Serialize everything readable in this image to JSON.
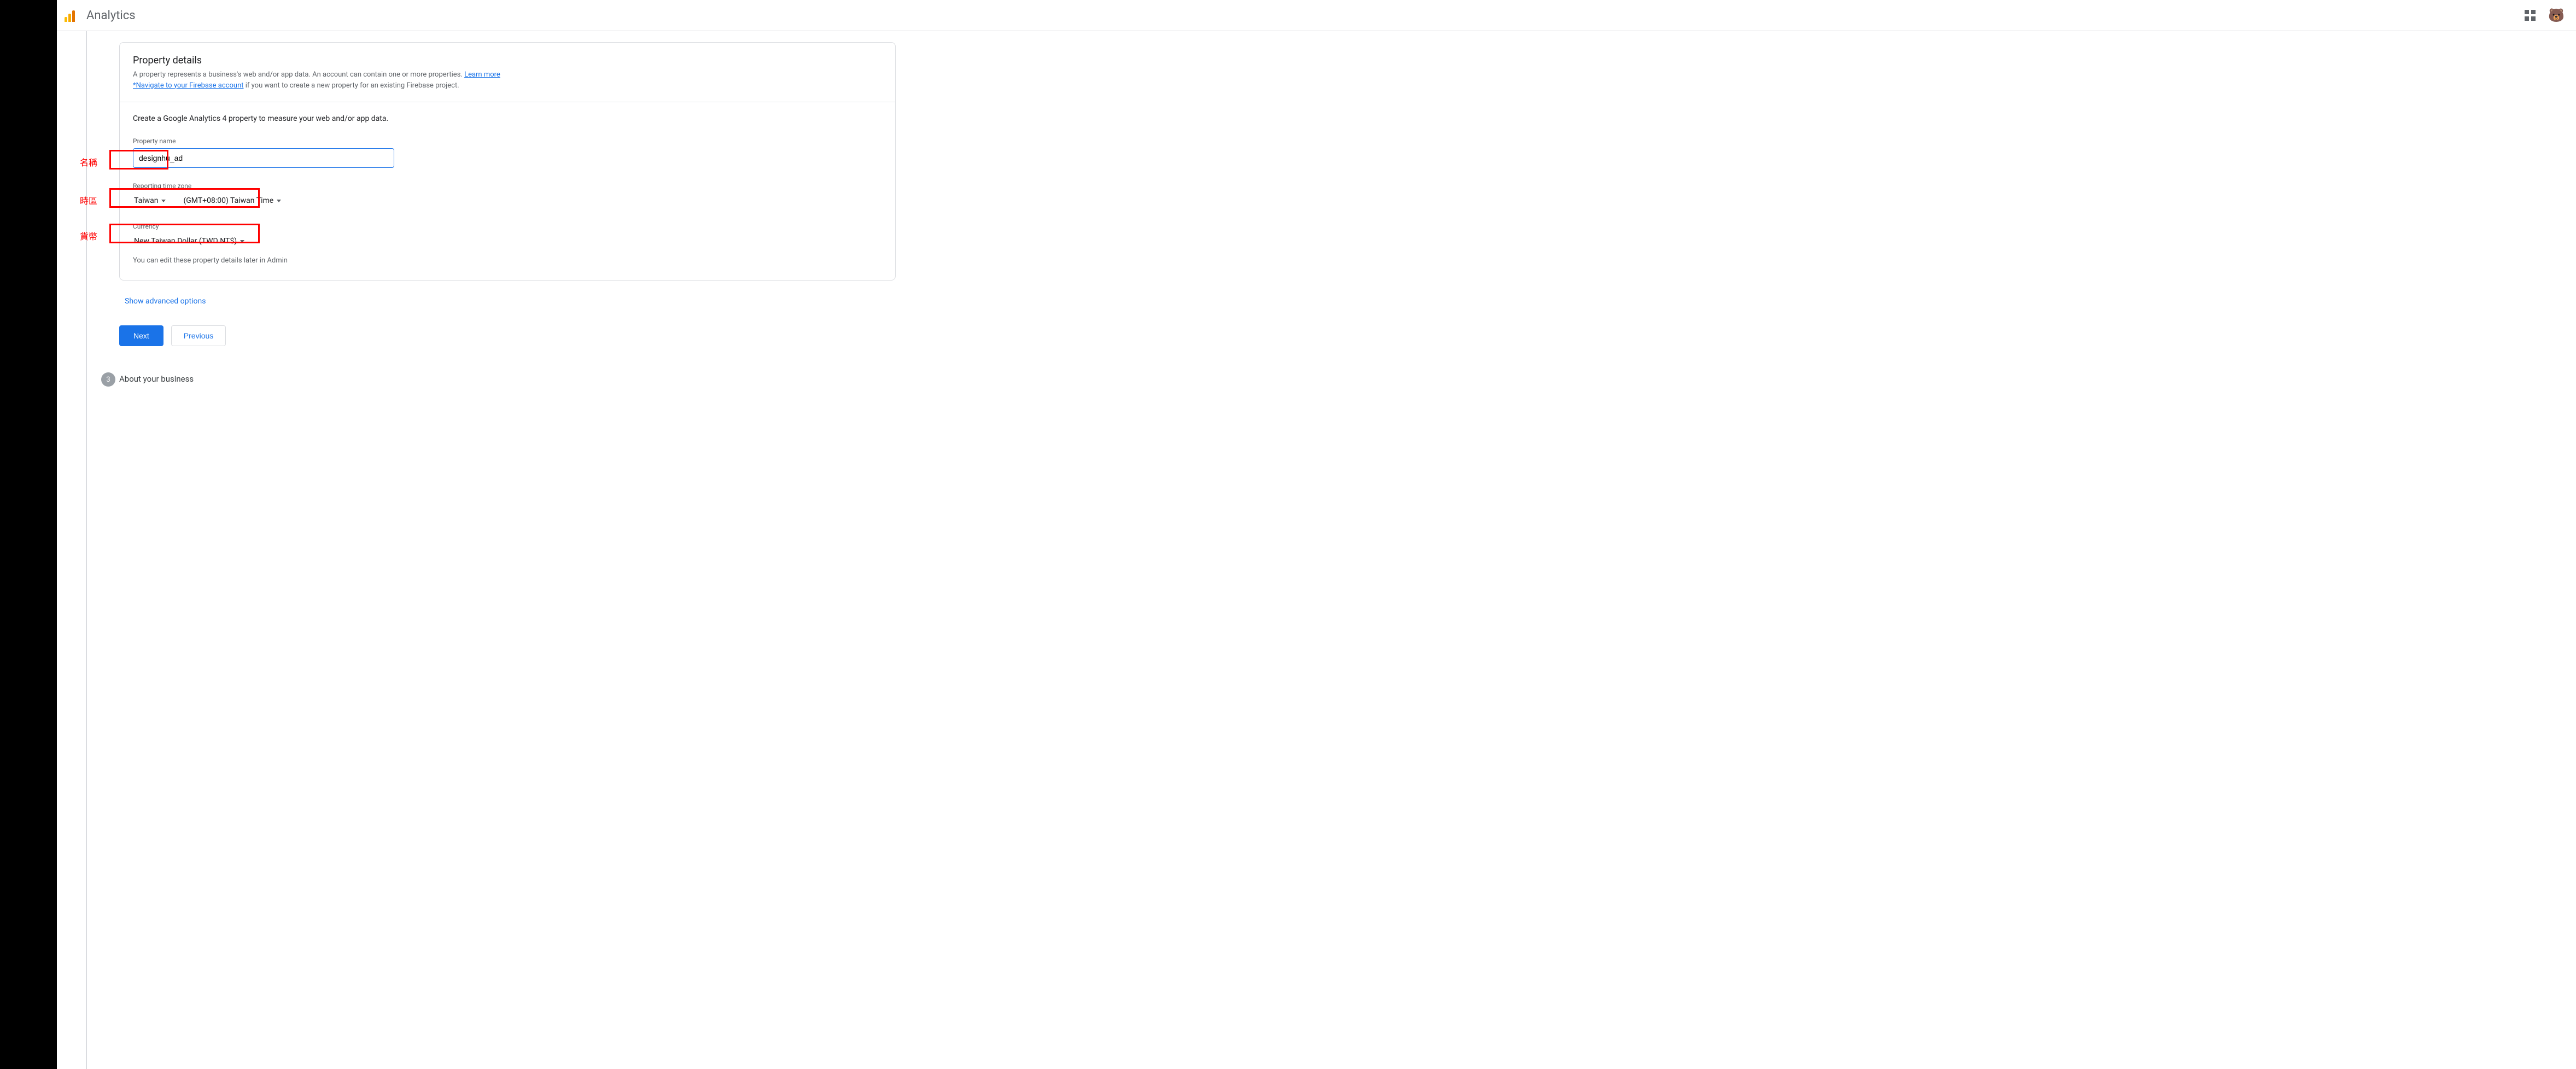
{
  "header": {
    "brand": "Analytics"
  },
  "card": {
    "title": "Property details",
    "desc_prefix": "A property represents a business's web and/or app data. An account can contain one or more properties. ",
    "learn_more": "Learn more",
    "firebase_link": "*Navigate to your Firebase account",
    "firebase_suffix": " if you want to create a new property for an existing Firebase project.",
    "subtitle": "Create a Google Analytics 4 property to measure your web and/or app data.",
    "property_name_label": "Property name",
    "property_name_value": "designhu_ad",
    "timezone_label": "Reporting time zone",
    "timezone_country": "Taiwan",
    "timezone_offset": "(GMT+08:00) Taiwan Time",
    "currency_label": "Currency",
    "currency_value": "New Taiwan Dollar (TWD NT$)",
    "hint": "You can edit these property details later in Admin"
  },
  "show_advanced": "Show advanced options",
  "buttons": {
    "next": "Next",
    "previous": "Previous"
  },
  "step3": {
    "number": "3",
    "label": "About your business"
  },
  "annotations": {
    "name": "名稱",
    "timezone": "時區",
    "currency": "貨幣"
  }
}
